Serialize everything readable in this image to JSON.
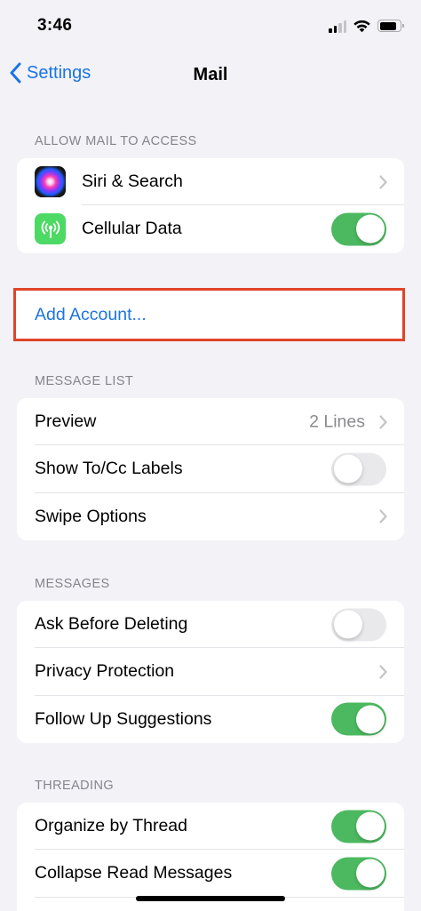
{
  "status_bar": {
    "time": "3:46"
  },
  "nav": {
    "back_label": "Settings",
    "title": "Mail"
  },
  "sections": {
    "allow_access": {
      "header": "ALLOW MAIL TO ACCESS",
      "rows": [
        {
          "label": "Siri & Search",
          "icon": "siri-icon",
          "accessory": "chevron"
        },
        {
          "label": "Cellular Data",
          "icon": "cellular-antenna-icon",
          "toggle": true
        }
      ]
    },
    "add_account": {
      "label": "Add Account..."
    },
    "message_list": {
      "header": "MESSAGE LIST",
      "rows": [
        {
          "label": "Preview",
          "detail": "2 Lines",
          "accessory": "chevron"
        },
        {
          "label": "Show To/Cc Labels",
          "toggle": false
        },
        {
          "label": "Swipe Options",
          "accessory": "chevron"
        }
      ]
    },
    "messages": {
      "header": "MESSAGES",
      "rows": [
        {
          "label": "Ask Before Deleting",
          "toggle": false
        },
        {
          "label": "Privacy Protection",
          "accessory": "chevron"
        },
        {
          "label": "Follow Up Suggestions",
          "toggle": true
        }
      ]
    },
    "threading": {
      "header": "THREADING",
      "rows": [
        {
          "label": "Organize by Thread",
          "toggle": true
        },
        {
          "label": "Collapse Read Messages",
          "toggle": true
        }
      ]
    }
  },
  "colors": {
    "accent": "#1b74e4",
    "toggle_on": "#4cb960",
    "toggle_off": "#e9e9eb",
    "highlight_border": "#e0442a",
    "background": "#f2f2f7"
  }
}
